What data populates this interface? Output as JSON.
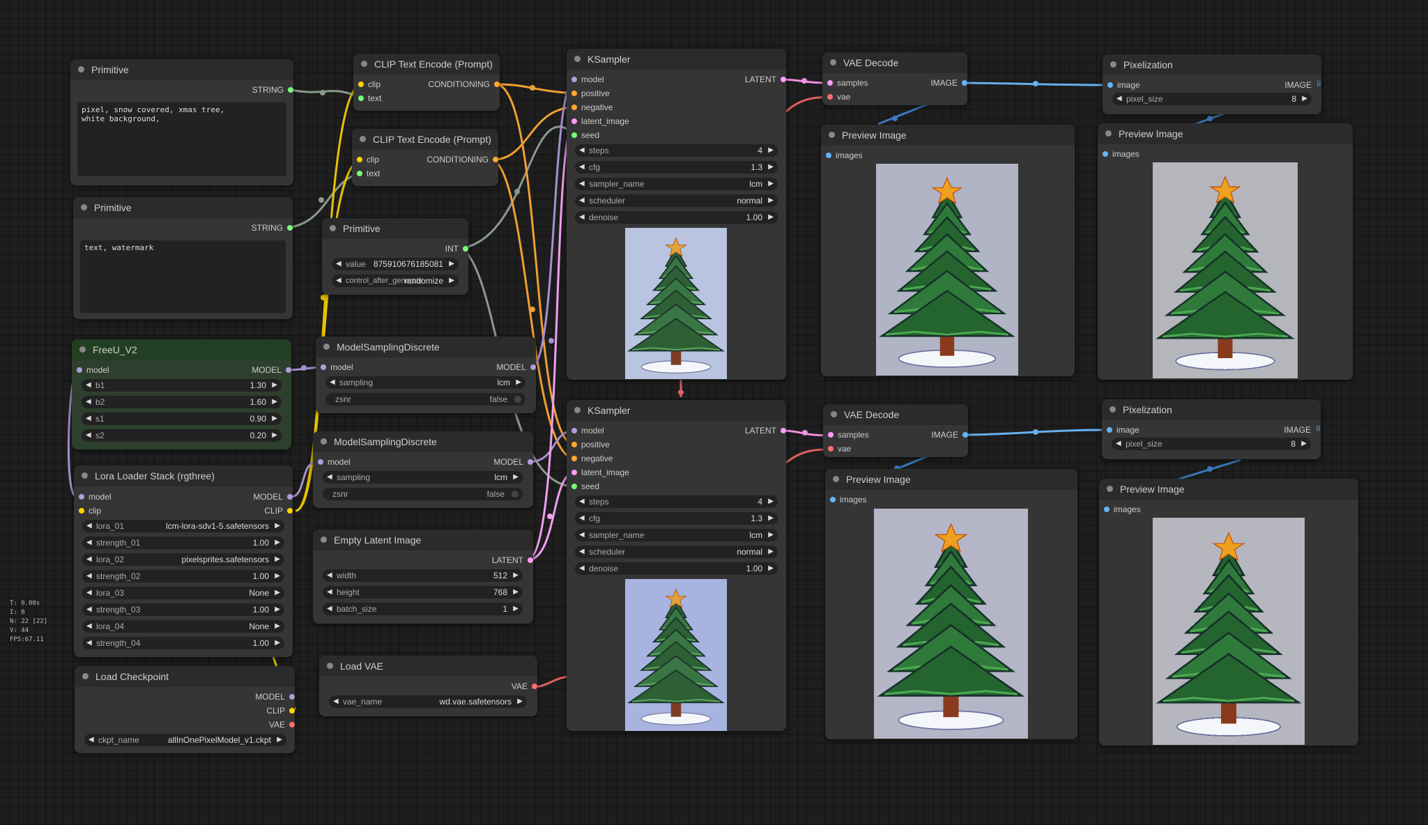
{
  "colors": {
    "model": "#b39ddb",
    "clip": "#ffd500",
    "conditioning": "#ffa931",
    "latent": "#ff9cf9",
    "vae": "#ff6e6e",
    "image": "#64b5f6",
    "string": "#77ff77",
    "int": "#77ff77"
  },
  "stats": [
    "T: 0.00s",
    "I: 0",
    "N: 22 [22]",
    "V: 44",
    "FPS:67.11"
  ],
  "nodes": {
    "primitive1": {
      "title": "Primitive",
      "out": "STRING",
      "text": "pixel, snow covered, xmas tree,\nwhite background,"
    },
    "primitive2": {
      "title": "Primitive",
      "out": "STRING",
      "text": "text, watermark"
    },
    "primitive3": {
      "title": "Primitive",
      "out": "INT",
      "w1_label": "value",
      "w1_value": "875910676185081",
      "w2_label": "control_after_generate",
      "w2_value": "randomize"
    },
    "clip1": {
      "title": "CLIP Text Encode (Prompt)",
      "in1": "clip",
      "in2": "text",
      "out": "CONDITIONING"
    },
    "clip2": {
      "title": "CLIP Text Encode (Prompt)",
      "in1": "clip",
      "in2": "text",
      "out": "CONDITIONING"
    },
    "freeu": {
      "title": "FreeU_V2",
      "in": "model",
      "out": "MODEL",
      "widgets": [
        {
          "label": "b1",
          "value": "1.30"
        },
        {
          "label": "b2",
          "value": "1.60"
        },
        {
          "label": "s1",
          "value": "0.90"
        },
        {
          "label": "s2",
          "value": "0.20"
        }
      ]
    },
    "msd1": {
      "title": "ModelSamplingDiscrete",
      "in": "model",
      "out": "MODEL",
      "sampling_label": "sampling",
      "sampling_value": "lcm",
      "zsnr_label": "zsnr",
      "zsnr_value": "false"
    },
    "msd2": {
      "title": "ModelSamplingDiscrete",
      "in": "model",
      "out": "MODEL",
      "sampling_label": "sampling",
      "sampling_value": "lcm",
      "zsnr_label": "zsnr",
      "zsnr_value": "false"
    },
    "lora": {
      "title": "Lora Loader Stack (rgthree)",
      "in1": "model",
      "in2": "clip",
      "out1": "MODEL",
      "out2": "CLIP",
      "widgets": [
        {
          "label": "lora_01",
          "value": "lcm-lora-sdv1-5.safetensors"
        },
        {
          "label": "strength_01",
          "value": "1.00"
        },
        {
          "label": "lora_02",
          "value": "pixelsprites.safetensors"
        },
        {
          "label": "strength_02",
          "value": "1.00"
        },
        {
          "label": "lora_03",
          "value": "None"
        },
        {
          "label": "strength_03",
          "value": "1.00"
        },
        {
          "label": "lora_04",
          "value": "None"
        },
        {
          "label": "strength_04",
          "value": "1.00"
        }
      ]
    },
    "checkpoint": {
      "title": "Load Checkpoint",
      "out1": "MODEL",
      "out2": "CLIP",
      "out3": "VAE",
      "w_label": "ckpt_name",
      "w_value": "allInOnePixelModel_v1.ckpt"
    },
    "latent": {
      "title": "Empty Latent Image",
      "out": "LATENT",
      "widgets": [
        {
          "label": "width",
          "value": "512"
        },
        {
          "label": "height",
          "value": "768"
        },
        {
          "label": "batch_size",
          "value": "1"
        }
      ]
    },
    "loadvae": {
      "title": "Load VAE",
      "out": "VAE",
      "w_label": "vae_name",
      "w_value": "wd.vae.safetensors"
    },
    "ks1": {
      "title": "KSampler",
      "inputs": [
        "model",
        "positive",
        "negative",
        "latent_image",
        "seed"
      ],
      "out": "LATENT",
      "widgets": [
        {
          "label": "steps",
          "value": "4"
        },
        {
          "label": "cfg",
          "value": "1.3"
        },
        {
          "label": "sampler_name",
          "value": "lcm"
        },
        {
          "label": "scheduler",
          "value": "normal"
        },
        {
          "label": "denoise",
          "value": "1.00"
        }
      ]
    },
    "ks2": {
      "title": "KSampler",
      "inputs": [
        "model",
        "positive",
        "negative",
        "latent_image",
        "seed"
      ],
      "out": "LATENT",
      "widgets": [
        {
          "label": "steps",
          "value": "4"
        },
        {
          "label": "cfg",
          "value": "1.3"
        },
        {
          "label": "sampler_name",
          "value": "lcm"
        },
        {
          "label": "scheduler",
          "value": "normal"
        },
        {
          "label": "denoise",
          "value": "1.00"
        }
      ]
    },
    "vaedec1": {
      "title": "VAE Decode",
      "in1": "samples",
      "in2": "vae",
      "out": "IMAGE"
    },
    "vaedec2": {
      "title": "VAE Decode",
      "in1": "samples",
      "in2": "vae",
      "out": "IMAGE"
    },
    "pix1": {
      "title": "Pixelization",
      "in": "image",
      "out": "IMAGE",
      "w_label": "pixel_size",
      "w_value": "8"
    },
    "pix2": {
      "title": "Pixelization",
      "in": "image",
      "out": "IMAGE",
      "w_label": "pixel_size",
      "w_value": "8"
    },
    "prev1": {
      "title": "Preview Image",
      "in": "images"
    },
    "prev2": {
      "title": "Preview Image",
      "in": "images"
    },
    "prev3": {
      "title": "Preview Image",
      "in": "images"
    },
    "prev4": {
      "title": "Preview Image",
      "in": "images"
    }
  }
}
